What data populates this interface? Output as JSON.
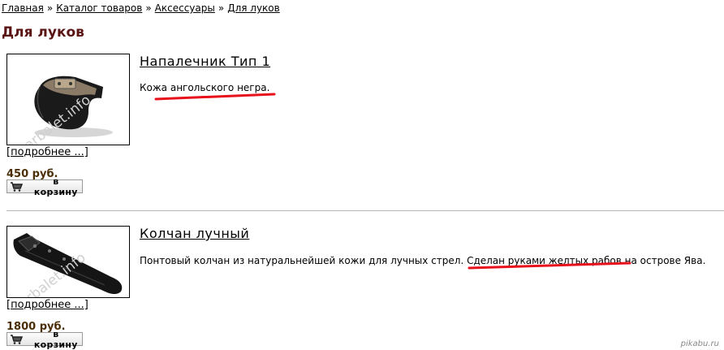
{
  "breadcrumb": [
    {
      "label": "Главная"
    },
    {
      "label": "Каталог товаров"
    },
    {
      "label": "Аксессуары"
    },
    {
      "label": "Для луков"
    }
  ],
  "breadcrumb_separator": "»",
  "page_title": "Для луков",
  "products": [
    {
      "title": "Напалечник Тип 1",
      "description": "Кожа ангольского негра.",
      "more_link": "[подробнее ...]",
      "price": "450 руб.",
      "cart_label": "в корзину",
      "image_watermark": "arbalet.info"
    },
    {
      "title": "Колчан лучный",
      "description": "Понтовый колчан из натуральнейшей кожи для лучных стрел. Сделан руками желтых рабов на острове Ява.",
      "more_link": "[подробнее ...]",
      "price": "1800 руб.",
      "cart_label": "в корзину",
      "image_watermark": "arbalet.info"
    }
  ],
  "site_watermark": "pikabu.ru",
  "colors": {
    "title": "#5a1414",
    "price": "#4a2e06",
    "underline_marker": "#e8101a",
    "divider": "#b5b5b5"
  }
}
